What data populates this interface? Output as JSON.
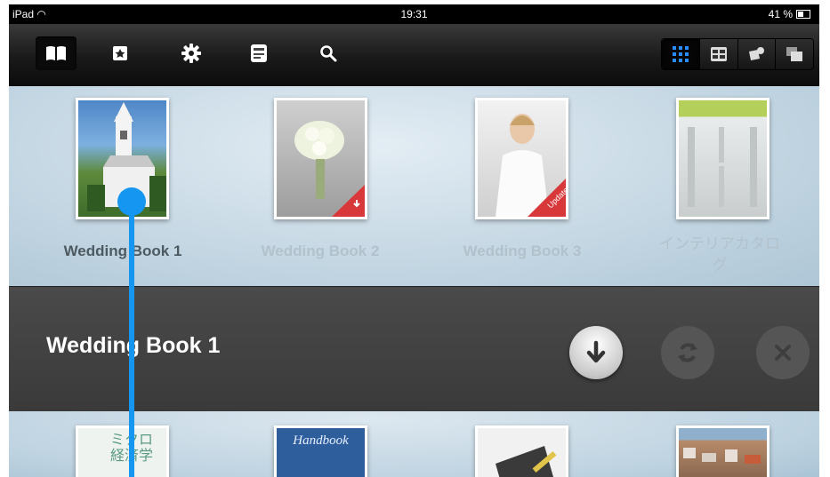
{
  "status_bar": {
    "device": "iPad",
    "time": "19:31",
    "battery": "41 %"
  },
  "toolbar": {
    "left_icons": [
      "bookshelf-icon",
      "bookmark-icon",
      "gear-icon",
      "news-icon",
      "search-icon"
    ],
    "view_icons": [
      "grid-view-icon",
      "list-view-icon",
      "cart-view-icon",
      "stack-view-icon"
    ]
  },
  "shelf": {
    "books": [
      {
        "title": "Wedding Book 1"
      },
      {
        "title": "Wedding Book 2"
      },
      {
        "title": "Wedding Book 3"
      },
      {
        "title": "インテリアカタロ\nグ"
      }
    ]
  },
  "detail": {
    "title": "Wedding Book 1"
  },
  "shelf2": {
    "covers": [
      {
        "text": "ミクロ\n経済学"
      },
      {
        "text": "Handbook"
      },
      {
        "text": ""
      },
      {
        "text": ""
      }
    ]
  },
  "colors": {
    "accent_touch": "#1596f0",
    "toolbar_bg": "#191919",
    "shelf_bg": "#c6d8e4",
    "detail_bg": "#3f3f3f"
  }
}
